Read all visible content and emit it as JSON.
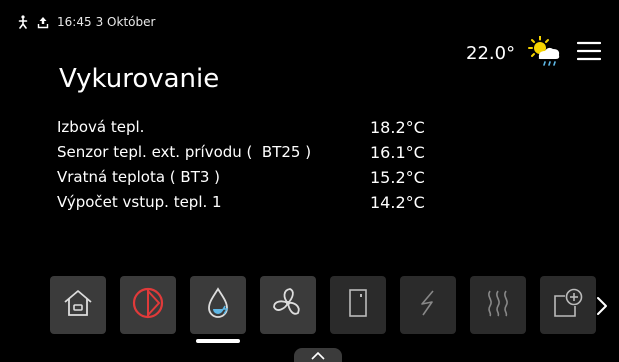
{
  "status_bar": {
    "time": "16:45",
    "date": "3 Október",
    "icons": [
      "person-icon",
      "upload-icon"
    ]
  },
  "weather": {
    "temperature": "22.0°",
    "icon": "partly-cloudy-rain-icon"
  },
  "page": {
    "title": "Vykurovanie"
  },
  "readings": [
    {
      "label": "Izbová tepl.",
      "value": "18.2°C"
    },
    {
      "label": "Senzor tepl. ext. prívodu (  BT25 )",
      "value": "16.1°C"
    },
    {
      "label": "Vratná teplota ( BT3 )",
      "value": "15.2°C"
    },
    {
      "label": "Výpočet vstup. tepl. 1",
      "value": "14.2°C"
    }
  ],
  "dock": {
    "items": [
      {
        "icon": "home-icon"
      },
      {
        "icon": "power-circle-icon"
      },
      {
        "icon": "water-drop-icon",
        "selected": true
      },
      {
        "icon": "fan-icon"
      },
      {
        "icon": "cabinet-icon"
      },
      {
        "icon": "lightning-icon"
      },
      {
        "icon": "heat-waves-icon"
      },
      {
        "icon": "add-device-icon"
      }
    ]
  },
  "colors": {
    "background": "#000000",
    "tile": "#3b3b3b",
    "power_red": "#e03a3a",
    "sun_yellow": "#f5d300",
    "drop_blue": "#5fb8e6"
  }
}
